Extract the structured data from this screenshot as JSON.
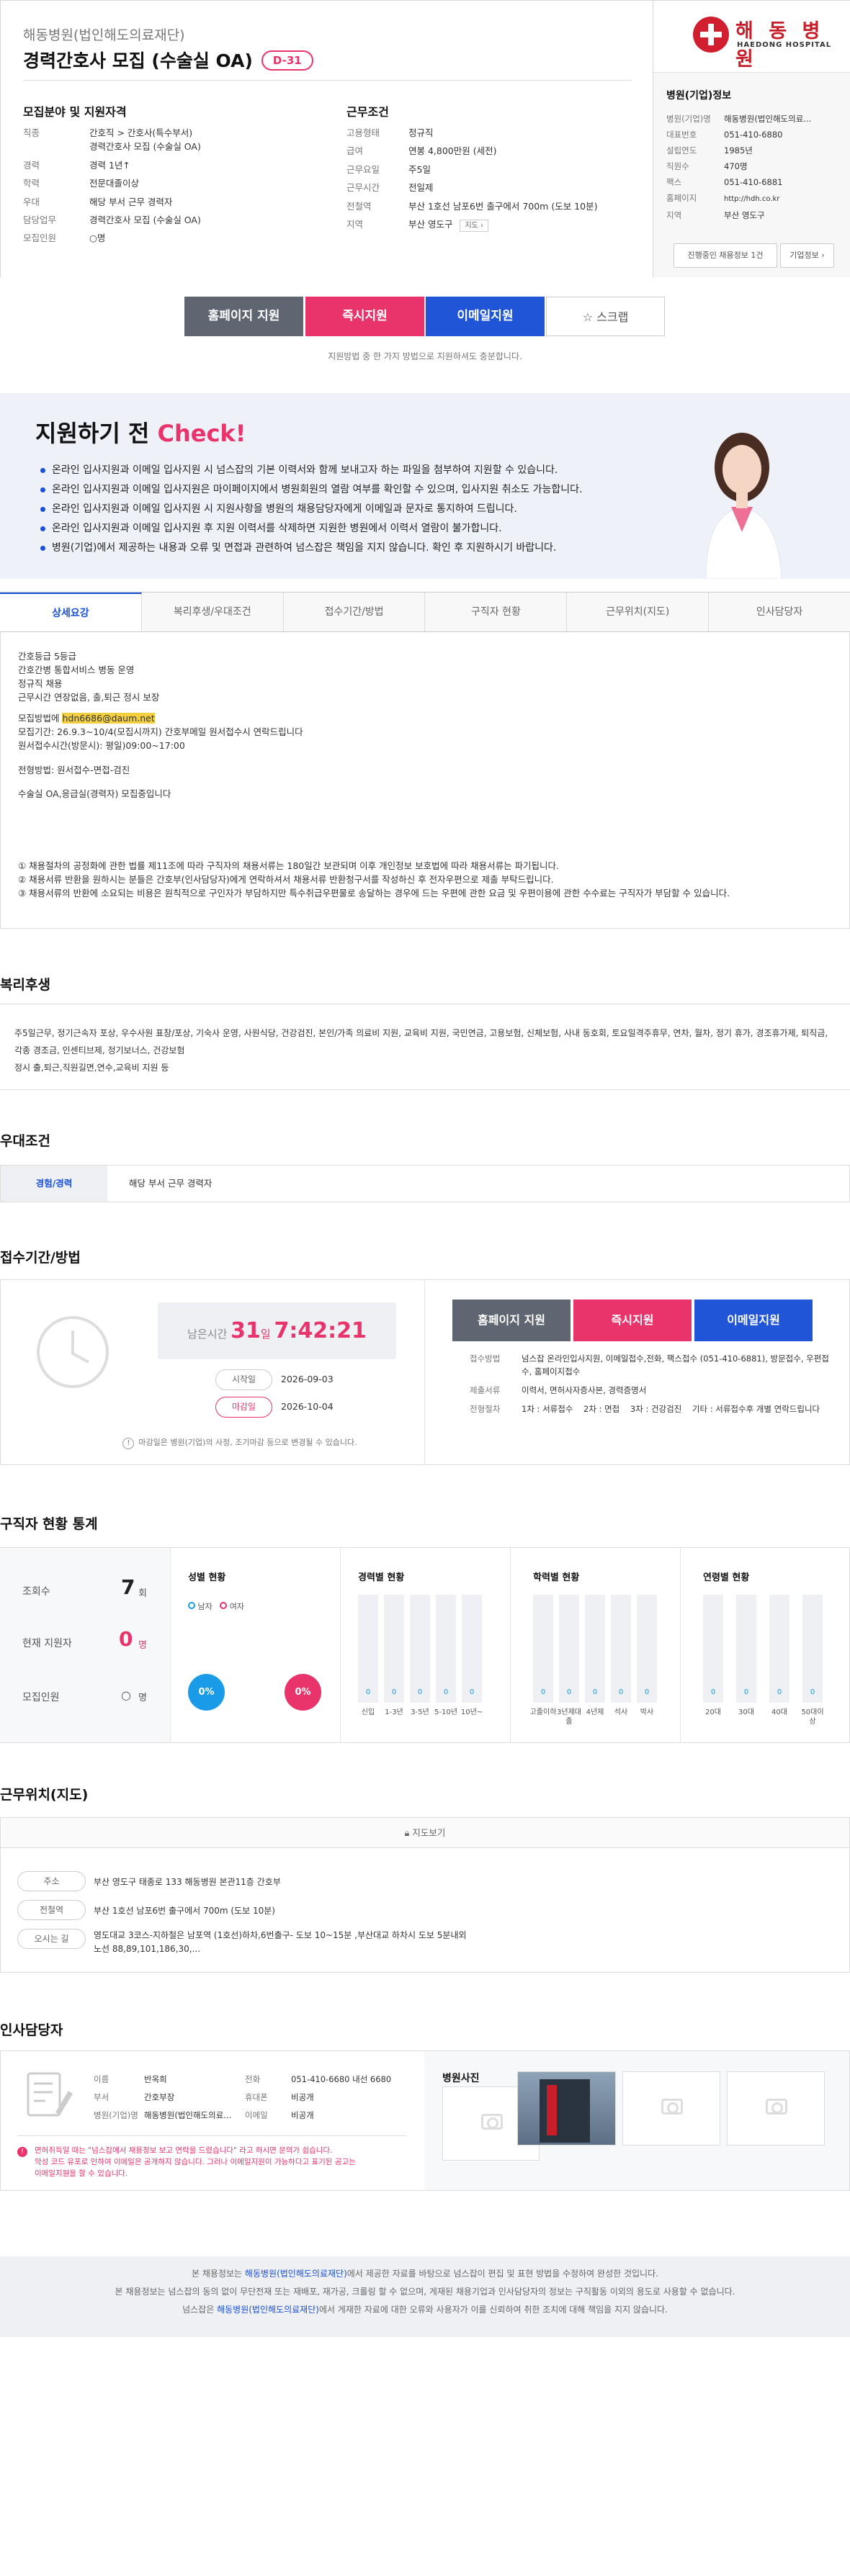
{
  "header": {
    "org": "해동병원(법인해도의료재단)",
    "title": "경력간호사 모집 (수술실 OA)",
    "dday": "D-31"
  },
  "qualifications": {
    "title": "모집분야 및 지원자격",
    "rows": [
      {
        "k": "직종",
        "v": "간호직 > 간호사(특수부서)"
      },
      {
        "k": "",
        "v": "경력간호사 모집 (수술실 OA)"
      },
      {
        "k": "경력",
        "v": "경력 1년↑"
      },
      {
        "k": "학력",
        "v": "전문대졸이상"
      },
      {
        "k": "우대",
        "v": "해당 부서 근무 경력자"
      },
      {
        "k": "담당업무",
        "v": "경력간호사 모집 (수술실 OA)"
      },
      {
        "k": "모집인원",
        "v": "○명"
      }
    ]
  },
  "conditions": {
    "title": "근무조건",
    "rows": [
      {
        "k": "고용형태",
        "v": "정규직"
      },
      {
        "k": "급여",
        "v": "연봉 4,800만원 (세전)"
      },
      {
        "k": "근무요일",
        "v": "주5일"
      },
      {
        "k": "근무시간",
        "v": "전일제"
      },
      {
        "k": "전철역",
        "v": "남포6번 출구에서 700m (도보 10분)",
        "sub": "부산 1호선"
      },
      {
        "k": "지역",
        "v": "부산 영도구",
        "btn": "지도"
      }
    ]
  },
  "hospital": {
    "logo_text": "해 동 병 원",
    "logo_sub": "HAEDONG HOSPITAL",
    "title": "병원(기업)정보",
    "rows": [
      {
        "k": "병원(기업)명",
        "v": "해동병원(법인해도의료..."
      },
      {
        "k": "대표번호",
        "v": "051-410-6880"
      },
      {
        "k": "설립연도",
        "v": "1985년"
      },
      {
        "k": "직원수",
        "v": "470명"
      },
      {
        "k": "팩스",
        "v": "051-410-6881"
      },
      {
        "k": "홈페이지",
        "v": "http://hdh.co.kr"
      },
      {
        "k": "지역",
        "v": "부산 영도구"
      }
    ],
    "btn_jobs": "진행중인 채용정보 1건",
    "btn_info": "기업정보"
  },
  "apply": {
    "homepage": "홈페이지 지원",
    "instant": "즉시지원",
    "email": "이메일지원",
    "scrap": "스크랩",
    "notice": "지원방법 중 한 가지 방법으로 지원하셔도 충분합니다."
  },
  "check": {
    "title_a": "지원하기 전 ",
    "title_b": "Check!",
    "items": [
      "온라인 입사지원과 이메일 입사지원 시 넘스잡의 기본 이력서와 함께 보내고자 하는 파일을 첨부하여 지원할 수 있습니다.",
      "온라인 입사지원과 이메일 입사지원은 마이페이지에서 병원회원의 열람 여부를 확인할 수 있으며, 입사지원 취소도 가능합니다.",
      "온라인 입사지원과 이메일 입사지원 시 지원사항을 병원의 채용담당자에게 이메일과 문자로 통지하여 드립니다.",
      "온라인 입사지원과 이메일 입사지원 후 지원 이력서를 삭제하면 지원한 병원에서 이력서 열람이 불가합니다.",
      "병원(기업)에서 제공하는 내용과 오류 및 면접과 관련하여 넘스잡은 책임을 지지 않습니다. 확인 후 지원하시기 바랍니다."
    ]
  },
  "tabs": [
    "상세요강",
    "복리후생/우대조건",
    "접수기간/방법",
    "구직자 현황",
    "근무위치(지도)",
    "인사담당자"
  ],
  "detail": {
    "lines1": "간호등급 5등급\n간호간병 통합서비스 병동 운영\n정규직 채용\n근무시간 연장없음, 출,퇴근 정시 보장",
    "email_label": "모집방법에 ",
    "email": "hdn6686@daum.net",
    "lines2": "모집기간:  26.9.3~10/4(모집시까지) 간호부메일 원서접수시 연락드립니다\n원서접수시간(방문시):  평일)09:00~17:00",
    "lines3": "전형방법: 원서접수-면접-검진",
    "lines4": "수술실 OA,응급실(경력자) 모집중입니다",
    "lines5": "① 채용절차의 공정화에 관한 법률 제11조에 따라 구직자의 채용서류는 180일간 보관되며 이후 개인정보 보호법에 따라 채용서류는 파기됩니다.\n② 채용서류 반환을 원하시는 분들은 간호부(인사담당자)에게 연락하셔서 채용서류 반환청구서를 작성하신 후 전자우편으로 제출 부탁드립니다.\n③ 채용서류의 반환에 소요되는 비용은 원칙적으로 구인자가 부담하지만 특수취급우편물로 송달하는 경우에 드는 우편에 관한 요금 및 우편이용에 관한 수수료는 구직자가 부담할 수 있습니다."
  },
  "welfare": {
    "title": "복리후생",
    "text": "주5일근무, 정기근속자 포상, 우수사원 표창/포상, 기숙사 운영, 사원식당, 건강검진, 본인/가족 의료비 지원, 교육비 지원, 국민연금, 고용보험, 신체보험, 사내 동호회, 토요일격주휴무, 연차, 월차, 정기 휴가, 경조휴가제, 퇴직금, 각종 경조금, 인센티브제, 정기보너스, 건강보험\n정시 출,퇴근,직원길면,연수,교육비 지원 등"
  },
  "preference": {
    "title": "우대조건",
    "k": "경험/경력",
    "v": "해당 부서 근무 경력자"
  },
  "period": {
    "title": "접수기간/방법",
    "timer_prefix": "남은시간",
    "timer_days": "31",
    "timer_day_unit": "일",
    "timer_time": "7:42:21",
    "start_label": "시작일",
    "start": "2026-09-03",
    "end_label": "마감일",
    "end": "2026-10-04",
    "warn": "마감일은 병원(기업)의 사정, 조기마감 등으로 변경될 수 있습니다.",
    "rows": [
      {
        "k": "접수방법",
        "v": "넘스잡 온라인입사지원, 이메일접수,전화, 팩스접수 (051-410-6881), 방문접수, 우편접수, 홈페이지접수"
      },
      {
        "k": "제출서류",
        "v": "이력서, 면허사자증사본, 경력증명서"
      },
      {
        "k": "전형절차",
        "v": "1차 : 서류접수    2차 : 면접    3차 : 건강검진    기타 : 서류접수후 개별 연락드립니다"
      }
    ]
  },
  "stats": {
    "title": "구직자 현황 통계",
    "views_label": "조회수",
    "views": "7",
    "views_unit": "회",
    "applicants_label": "현재 지원자",
    "applicants": "0",
    "applicants_unit": "명",
    "recruit_label": "모집인원",
    "recruit": "○",
    "recruit_unit": "명",
    "gender_title": "성별 현황",
    "male": "남자",
    "female": "여자",
    "male_pct": "0%",
    "female_pct": "0%",
    "career_title": "경력별 현황",
    "career": [
      "신입",
      "1-3년",
      "3-5년",
      "5-10년",
      "10년~"
    ],
    "edu_title": "학력별 현황",
    "edu": [
      "고졸이하",
      "3년제대졸",
      "4년제",
      "석사",
      "박사"
    ],
    "age_title": "연령별 현황",
    "age": [
      "20대",
      "30대",
      "40대",
      "50대이상"
    ],
    "zero": "0"
  },
  "location": {
    "title": "근무위치(지도)",
    "map_btn": "지도보기",
    "rows": [
      {
        "k": "주소",
        "v": "부산 영도구 태종로 133 해동병원 본관11층 간호부"
      },
      {
        "k": "전철역",
        "v": "부산 1호선 남포6번 출구에서 700m (도보 10분)"
      },
      {
        "k": "오시는 길",
        "v": "영도대교 3코스-지하철은 남포역 (1호선)하차,6번출구- 도보 10~15분 ,부산대교 하차시 도보 5분내외\n노선 88,89,101,186,30,..."
      }
    ]
  },
  "hr": {
    "title": "인사담당자",
    "rows": [
      {
        "k": "이름",
        "v": "반옥희",
        "k2": "전화",
        "v2": "051-410-6680 내선 6680"
      },
      {
        "k": "부서",
        "v": "간호부장",
        "k2": "휴대폰",
        "v2": "비공개"
      },
      {
        "k": "병원(기업)명",
        "v": "해동병원(법인해도의료...",
        "k2": "이메일",
        "v2": "비공개"
      }
    ],
    "warn": "면허취득일 때는 \"넘스잡에서 채용정보 보고 연락을 드렸습니다\" 라고 하시면 문의가 쉽습니다.\n악성 코드 유포로 인하여 이메일은 공개하지 않습니다. 그러나 이메일지원이 가능하다고 표기된 공고는\n이메일지원을 할 수 있습니다.",
    "photo_title": "병원사진"
  },
  "footer": {
    "l1a": "본 채용정보는 ",
    "l1b": "해동병원(법인해도의료재단)",
    "l1c": "에서 제공한 자료를 바탕으로 넘스잡이 편집 및 표현 방법을 수정하여 완성한 것입니다.",
    "l2": "본 채용정보는 넘스잡의 동의 없이 무단전재 또는 재배포, 재가공, 크롤링 할 수 없으며, 게재된 채용기업과 인사담당자의 정보는 구직활동 이외의 용도로 사용할 수 없습니다.",
    "l3a": "넘스잡은 ",
    "l3b": "해동병원(법인해도의료재단)",
    "l3c": "에서 게재한 자료에 대한 오류와 사용자가 이를 신뢰하여 취한 조치에 대해 책임을 지지 않습니다."
  },
  "colors": {
    "accent": "#1a4fd8",
    "pink": "#e8336b",
    "gray_btn": "#5f6672",
    "blue_btn": "#1f55d6"
  }
}
